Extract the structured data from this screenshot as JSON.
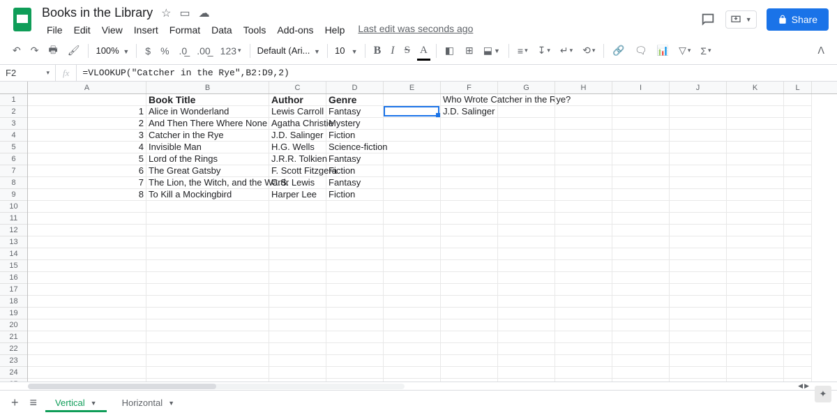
{
  "doc_title": "Books in the Library",
  "menu": [
    "File",
    "Edit",
    "View",
    "Insert",
    "Format",
    "Data",
    "Tools",
    "Add-ons",
    "Help"
  ],
  "last_edit": "Last edit was seconds ago",
  "share_label": "Share",
  "toolbar": {
    "zoom": "100%",
    "font": "Default (Ari...",
    "size": "10",
    "num_format": "123"
  },
  "namebox": "F2",
  "formula": "=VLOOKUP(\"Catcher in the Rye\",B2:D9,2)",
  "columns": [
    "A",
    "B",
    "C",
    "D",
    "E",
    "F",
    "G",
    "H",
    "I",
    "J",
    "K",
    "L"
  ],
  "row_count": 25,
  "headers": {
    "b": "Book Title",
    "c": "Author",
    "d": "Genre"
  },
  "question": "Who Wrote Catcher in the Rye?",
  "answer": "J.D. Salinger",
  "books": [
    {
      "n": "1",
      "title": "Alice in Wonderland",
      "author": "Lewis Carroll",
      "genre": "Fantasy"
    },
    {
      "n": "2",
      "title": "And Then There Where None",
      "author": "Agatha Christie",
      "genre": "Mystery"
    },
    {
      "n": "3",
      "title": "Catcher in the Rye",
      "author": "J.D. Salinger",
      "genre": "Fiction"
    },
    {
      "n": "4",
      "title": "Invisible Man",
      "author": "H.G. Wells",
      "genre": "Science-fiction"
    },
    {
      "n": "5",
      "title": "Lord of the Rings",
      "author": "J.R.R. Tolkien",
      "genre": "Fantasy"
    },
    {
      "n": "6",
      "title": "The Great Gatsby",
      "author": "F. Scott Fitzgera",
      "genre": "Fiction"
    },
    {
      "n": "7",
      "title": "The Lion, the Witch, and the Wardr",
      "author": "C.S. Lewis",
      "genre": "Fantasy"
    },
    {
      "n": "8",
      "title": "To Kill a Mockingbird",
      "author": "Harper Lee",
      "genre": "Fiction"
    }
  ],
  "sheets": {
    "active": "Vertical",
    "other": "Horizontal"
  },
  "active_cell": {
    "col": "F",
    "row": 2
  }
}
